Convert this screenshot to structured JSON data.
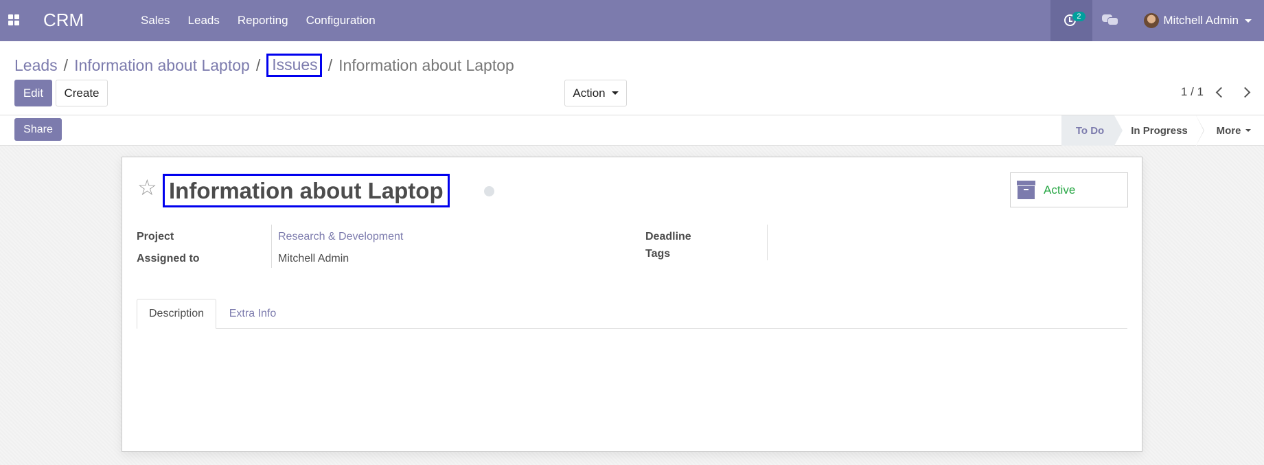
{
  "navbar": {
    "app_title": "CRM",
    "menu": [
      "Sales",
      "Leads",
      "Reporting",
      "Configuration"
    ],
    "activity_count": "2",
    "user_name": "Mitchell Admin"
  },
  "breadcrumb": {
    "items": [
      "Leads",
      "Information about Laptop",
      "Issues"
    ],
    "current": "Information about Laptop",
    "separator": "/"
  },
  "buttons": {
    "edit": "Edit",
    "create": "Create",
    "action": "Action",
    "share": "Share"
  },
  "pager": {
    "value": "1 / 1"
  },
  "stages": {
    "todo": "To Do",
    "in_progress": "In Progress",
    "more": "More",
    "active_stage": "To Do"
  },
  "record": {
    "title": "Information about Laptop",
    "active_label": "Active",
    "fields": {
      "project_label": "Project",
      "project_value": "Research & Development",
      "assigned_label": "Assigned to",
      "assigned_value": "Mitchell Admin",
      "deadline_label": "Deadline",
      "tags_label": "Tags"
    },
    "tabs": [
      "Description",
      "Extra Info"
    ]
  },
  "colors": {
    "brand": "#7c7bad",
    "highlight": "#0000ee",
    "active_green": "#28a745",
    "badge": "#00a09d"
  }
}
